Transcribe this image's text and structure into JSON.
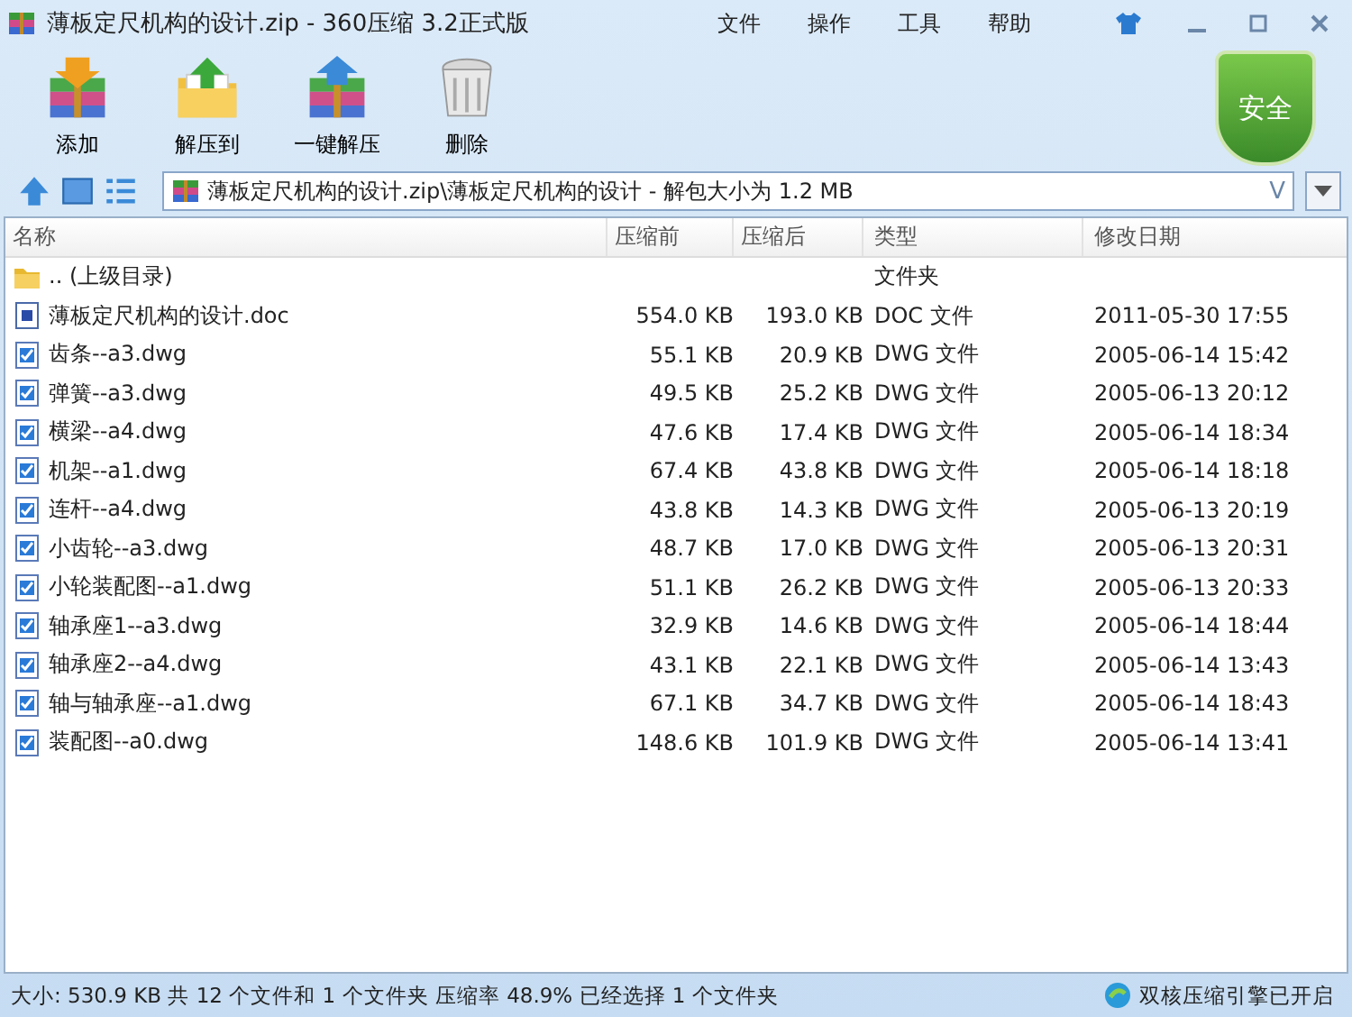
{
  "window": {
    "title": "薄板定尺机构的设计.zip - 360压缩 3.2正式版"
  },
  "menu": [
    "文件",
    "操作",
    "工具",
    "帮助"
  ],
  "toolbar": [
    {
      "label": "添加",
      "kind": "add"
    },
    {
      "label": "解压到",
      "kind": "extract"
    },
    {
      "label": "一键解压",
      "kind": "oneclick"
    },
    {
      "label": "删除",
      "kind": "delete"
    }
  ],
  "security_badge": "安全",
  "address": {
    "value": "薄板定尺机构的设计.zip\\薄板定尺机构的设计 - 解包大小为 1.2 MB",
    "dropdown": "V"
  },
  "table": {
    "columns": [
      "名称",
      "压缩前",
      "压缩后",
      "类型",
      "修改日期"
    ],
    "rows": [
      {
        "kind": "folder",
        "name": ".. (上级目录)",
        "size": "",
        "packed": "",
        "type": "文件夹",
        "date": ""
      },
      {
        "kind": "doc",
        "name": "薄板定尺机构的设计.doc",
        "size": "554.0 KB",
        "packed": "193.0 KB",
        "type": "DOC 文件",
        "date": "2011-05-30 17:55"
      },
      {
        "kind": "dwg",
        "name": "齿条--a3.dwg",
        "size": "55.1 KB",
        "packed": "20.9 KB",
        "type": "DWG 文件",
        "date": "2005-06-14 15:42"
      },
      {
        "kind": "dwg",
        "name": "弹簧--a3.dwg",
        "size": "49.5 KB",
        "packed": "25.2 KB",
        "type": "DWG 文件",
        "date": "2005-06-13 20:12"
      },
      {
        "kind": "dwg",
        "name": "横梁--a4.dwg",
        "size": "47.6 KB",
        "packed": "17.4 KB",
        "type": "DWG 文件",
        "date": "2005-06-14 18:34"
      },
      {
        "kind": "dwg",
        "name": "机架--a1.dwg",
        "size": "67.4 KB",
        "packed": "43.8 KB",
        "type": "DWG 文件",
        "date": "2005-06-14 18:18"
      },
      {
        "kind": "dwg",
        "name": "连杆--a4.dwg",
        "size": "43.8 KB",
        "packed": "14.3 KB",
        "type": "DWG 文件",
        "date": "2005-06-13 20:19"
      },
      {
        "kind": "dwg",
        "name": "小齿轮--a3.dwg",
        "size": "48.7 KB",
        "packed": "17.0 KB",
        "type": "DWG 文件",
        "date": "2005-06-13 20:31"
      },
      {
        "kind": "dwg",
        "name": "小轮装配图--a1.dwg",
        "size": "51.1 KB",
        "packed": "26.2 KB",
        "type": "DWG 文件",
        "date": "2005-06-13 20:33"
      },
      {
        "kind": "dwg",
        "name": "轴承座1--a3.dwg",
        "size": "32.9 KB",
        "packed": "14.6 KB",
        "type": "DWG 文件",
        "date": "2005-06-14 18:44"
      },
      {
        "kind": "dwg",
        "name": "轴承座2--a4.dwg",
        "size": "43.1 KB",
        "packed": "22.1 KB",
        "type": "DWG 文件",
        "date": "2005-06-14 13:43"
      },
      {
        "kind": "dwg",
        "name": "轴与轴承座--a1.dwg",
        "size": "67.1 KB",
        "packed": "34.7 KB",
        "type": "DWG 文件",
        "date": "2005-06-14 18:43"
      },
      {
        "kind": "dwg",
        "name": "装配图--a0.dwg",
        "size": "148.6 KB",
        "packed": "101.9 KB",
        "type": "DWG 文件",
        "date": "2005-06-14 13:41"
      }
    ]
  },
  "status_bar": {
    "summary": "大小: 530.9 KB 共 12 个文件和 1 个文件夹 压缩率 48.9% 已经选择 1 个文件夹",
    "engine": "双核压缩引擎已开启"
  }
}
